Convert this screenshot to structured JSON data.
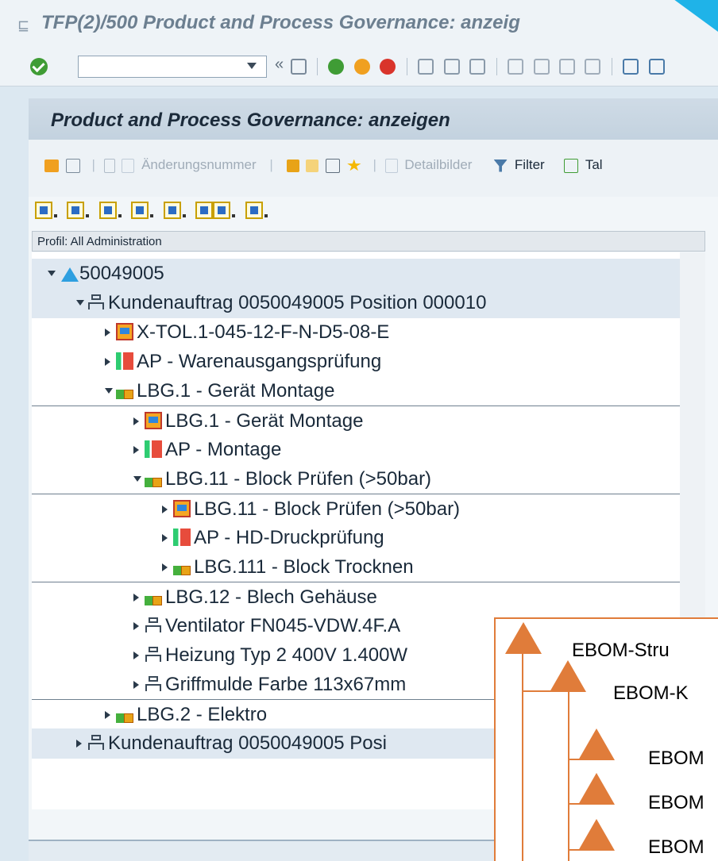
{
  "window": {
    "title": "TFP(2)/500 Product and Process Governance: anzeig"
  },
  "toolbar": {
    "command_field_value": "",
    "back_symbol": "«"
  },
  "panel": {
    "title": "Product and Process Governance: anzeigen",
    "tools": {
      "aenderungsnummer": "Änderungsnummer",
      "detailbilder": "Detailbilder",
      "filter": "Filter",
      "tab": "Tal"
    },
    "profil_label": "Profil: All Administration"
  },
  "tree": [
    {
      "label": "50049005",
      "icon": "root-icon",
      "state": "open",
      "level": 0,
      "highlight": true
    },
    {
      "label": "Kundenauftrag 0050049005 Position 000010",
      "icon": "sales-order-icon",
      "state": "open",
      "level": 1,
      "highlight": true
    },
    {
      "label": "X-TOL.1-045-12-F-N-D5-08-E",
      "icon": "material-icon",
      "state": "closed",
      "level": 2
    },
    {
      "label": "AP - Warenausgangsprüfung",
      "icon": "work-plan-icon",
      "state": "closed",
      "level": 2
    },
    {
      "label": "LBG.1 - Gerät Montage",
      "icon": "assembly-group-icon",
      "state": "open",
      "level": 2
    },
    {
      "label": "LBG.1 - Gerät Montage",
      "icon": "material-icon",
      "state": "closed",
      "level": 3,
      "border_top": true
    },
    {
      "label": "AP - Montage",
      "icon": "work-plan-icon",
      "state": "closed",
      "level": 3
    },
    {
      "label": "LBG.11 - Block Prüfen (>50bar)",
      "icon": "assembly-group-icon",
      "state": "open",
      "level": 3
    },
    {
      "label": "LBG.11 - Block Prüfen (>50bar)",
      "icon": "material-icon",
      "state": "closed",
      "level": 4,
      "border_top": true
    },
    {
      "label": "AP - HD-Druckprüfung",
      "icon": "work-plan-icon",
      "state": "closed",
      "level": 4
    },
    {
      "label": "LBG.111 - Block Trocknen",
      "icon": "assembly-group-icon",
      "state": "closed",
      "level": 4
    },
    {
      "label": "LBG.12 - Blech Gehäuse",
      "icon": "assembly-group-icon",
      "state": "closed",
      "level": 3,
      "border_top": true
    },
    {
      "label": "Ventilator FN045-VDW.4F.A",
      "icon": "sales-order-icon",
      "state": "closed",
      "level": 3
    },
    {
      "label": "Heizung Typ 2 400V 1.400W",
      "icon": "sales-order-icon",
      "state": "closed",
      "level": 3
    },
    {
      "label": "Griffmulde Farbe 113x67mm",
      "icon": "sales-order-icon",
      "state": "closed",
      "level": 3
    },
    {
      "label": "LBG.2 - Elektro",
      "icon": "assembly-group-icon",
      "state": "closed",
      "level": 2,
      "border_top": true
    },
    {
      "label": "Kundenauftrag 0050049005 Posi",
      "icon": "sales-order-icon",
      "state": "closed",
      "level": 1,
      "highlight": true
    }
  ],
  "overlay": {
    "labels": [
      "EBOM-Stru",
      "EBOM-K",
      "EBOM",
      "EBOM",
      "EBOM"
    ],
    "color": "#e07c3a"
  }
}
